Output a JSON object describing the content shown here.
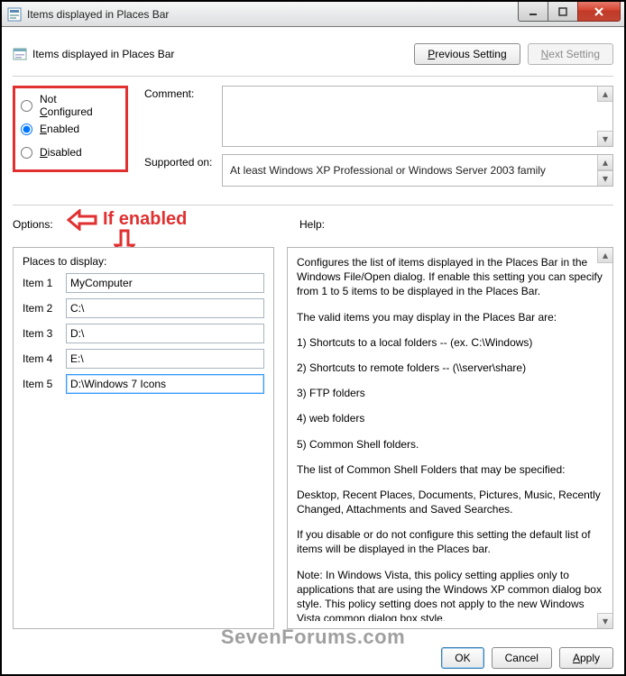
{
  "window": {
    "title": "Items displayed in Places Bar"
  },
  "header": {
    "title": "Items displayed in Places Bar",
    "prev_label": "Previous Setting",
    "prev_underline": "P",
    "next_label": "Next Setting",
    "next_underline": "N"
  },
  "radios": {
    "not_configured_pre": "Not ",
    "not_configured_ul": "C",
    "not_configured_post": "onfigured",
    "enabled_ul": "E",
    "enabled_post": "nabled",
    "disabled_ul": "D",
    "disabled_post": "isabled",
    "selected": "enabled"
  },
  "comment": {
    "label": "Comment:",
    "value": ""
  },
  "supported": {
    "label": "Supported on:",
    "value": "At least Windows XP Professional or Windows Server 2003 family"
  },
  "options": {
    "label": "Options:"
  },
  "help": {
    "label": "Help:"
  },
  "annotation": {
    "text": "If enabled"
  },
  "places": {
    "title": "Places to display:",
    "items": [
      {
        "label": "Item 1",
        "value": "MyComputer"
      },
      {
        "label": "Item 2",
        "value": "C:\\"
      },
      {
        "label": "Item 3",
        "value": "D:\\"
      },
      {
        "label": "Item 4",
        "value": "E:\\"
      },
      {
        "label": "Item 5",
        "value": "D:\\Windows 7 Icons"
      }
    ]
  },
  "help_text": {
    "p1": "Configures the list of items displayed in the Places Bar in the Windows File/Open dialog. If enable this setting you can specify from 1 to 5 items to be displayed in the Places Bar.",
    "p2": "The valid items you may display in the Places Bar are:",
    "p3": "1) Shortcuts to a local folders -- (ex. C:\\Windows)",
    "p4": "2) Shortcuts to remote folders -- (\\\\server\\share)",
    "p5": "3) FTP folders",
    "p6": "4) web folders",
    "p7": "5) Common Shell folders.",
    "p8": "The list of Common Shell Folders that may be specified:",
    "p9": "Desktop, Recent Places, Documents, Pictures, Music, Recently Changed, Attachments and Saved Searches.",
    "p10": "If you disable or do not configure this setting the default list of items will be displayed in the Places bar.",
    "p11": "Note: In Windows Vista, this policy  setting applies only to applications that are using the Windows XP common dialog box style. This policy setting does not apply to the new Windows Vista common dialog box style."
  },
  "buttons": {
    "ok": "OK",
    "cancel": "Cancel",
    "apply": "Apply",
    "apply_ul": "A",
    "apply_post": "pply"
  },
  "watermark": "SevenForums.com"
}
